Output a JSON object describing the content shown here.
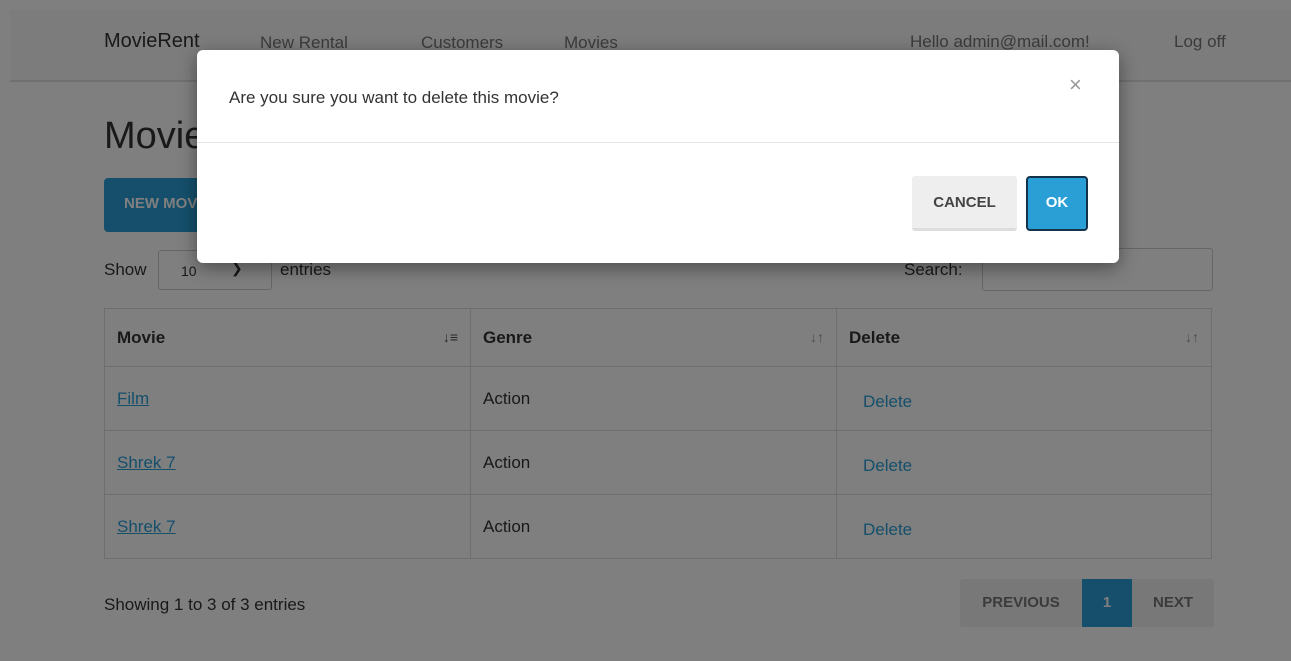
{
  "navbar": {
    "brand": "MovieRent",
    "links": [
      "New Rental",
      "Customers",
      "Movies"
    ],
    "greeting": "Hello admin@mail.com!",
    "logoff": "Log off"
  },
  "page": {
    "title": "Movies",
    "new_button": "NEW MOVIE"
  },
  "table_controls": {
    "show_label": "Show",
    "length_value": "10",
    "entries_label": "entries",
    "search_label": "Search:",
    "search_value": ""
  },
  "table": {
    "headers": [
      "Movie",
      "Genre",
      "Delete"
    ],
    "rows": [
      {
        "movie": "Film",
        "genre": "Action",
        "delete": "Delete"
      },
      {
        "movie": "Shrek 7",
        "genre": "Action",
        "delete": "Delete"
      },
      {
        "movie": "Shrek 7",
        "genre": "Action",
        "delete": "Delete"
      }
    ]
  },
  "footer": {
    "info": "Showing 1 to 3 of 3 entries",
    "pagination": {
      "previous": "PREVIOUS",
      "current": "1",
      "next": "NEXT"
    }
  },
  "modal": {
    "message": "Are you sure you want to delete this movie?",
    "close": "×",
    "cancel": "CANCEL",
    "ok": "OK"
  },
  "colors": {
    "accent": "#2a9fd6",
    "overlay": "rgba(0,0,0,0.5)"
  }
}
